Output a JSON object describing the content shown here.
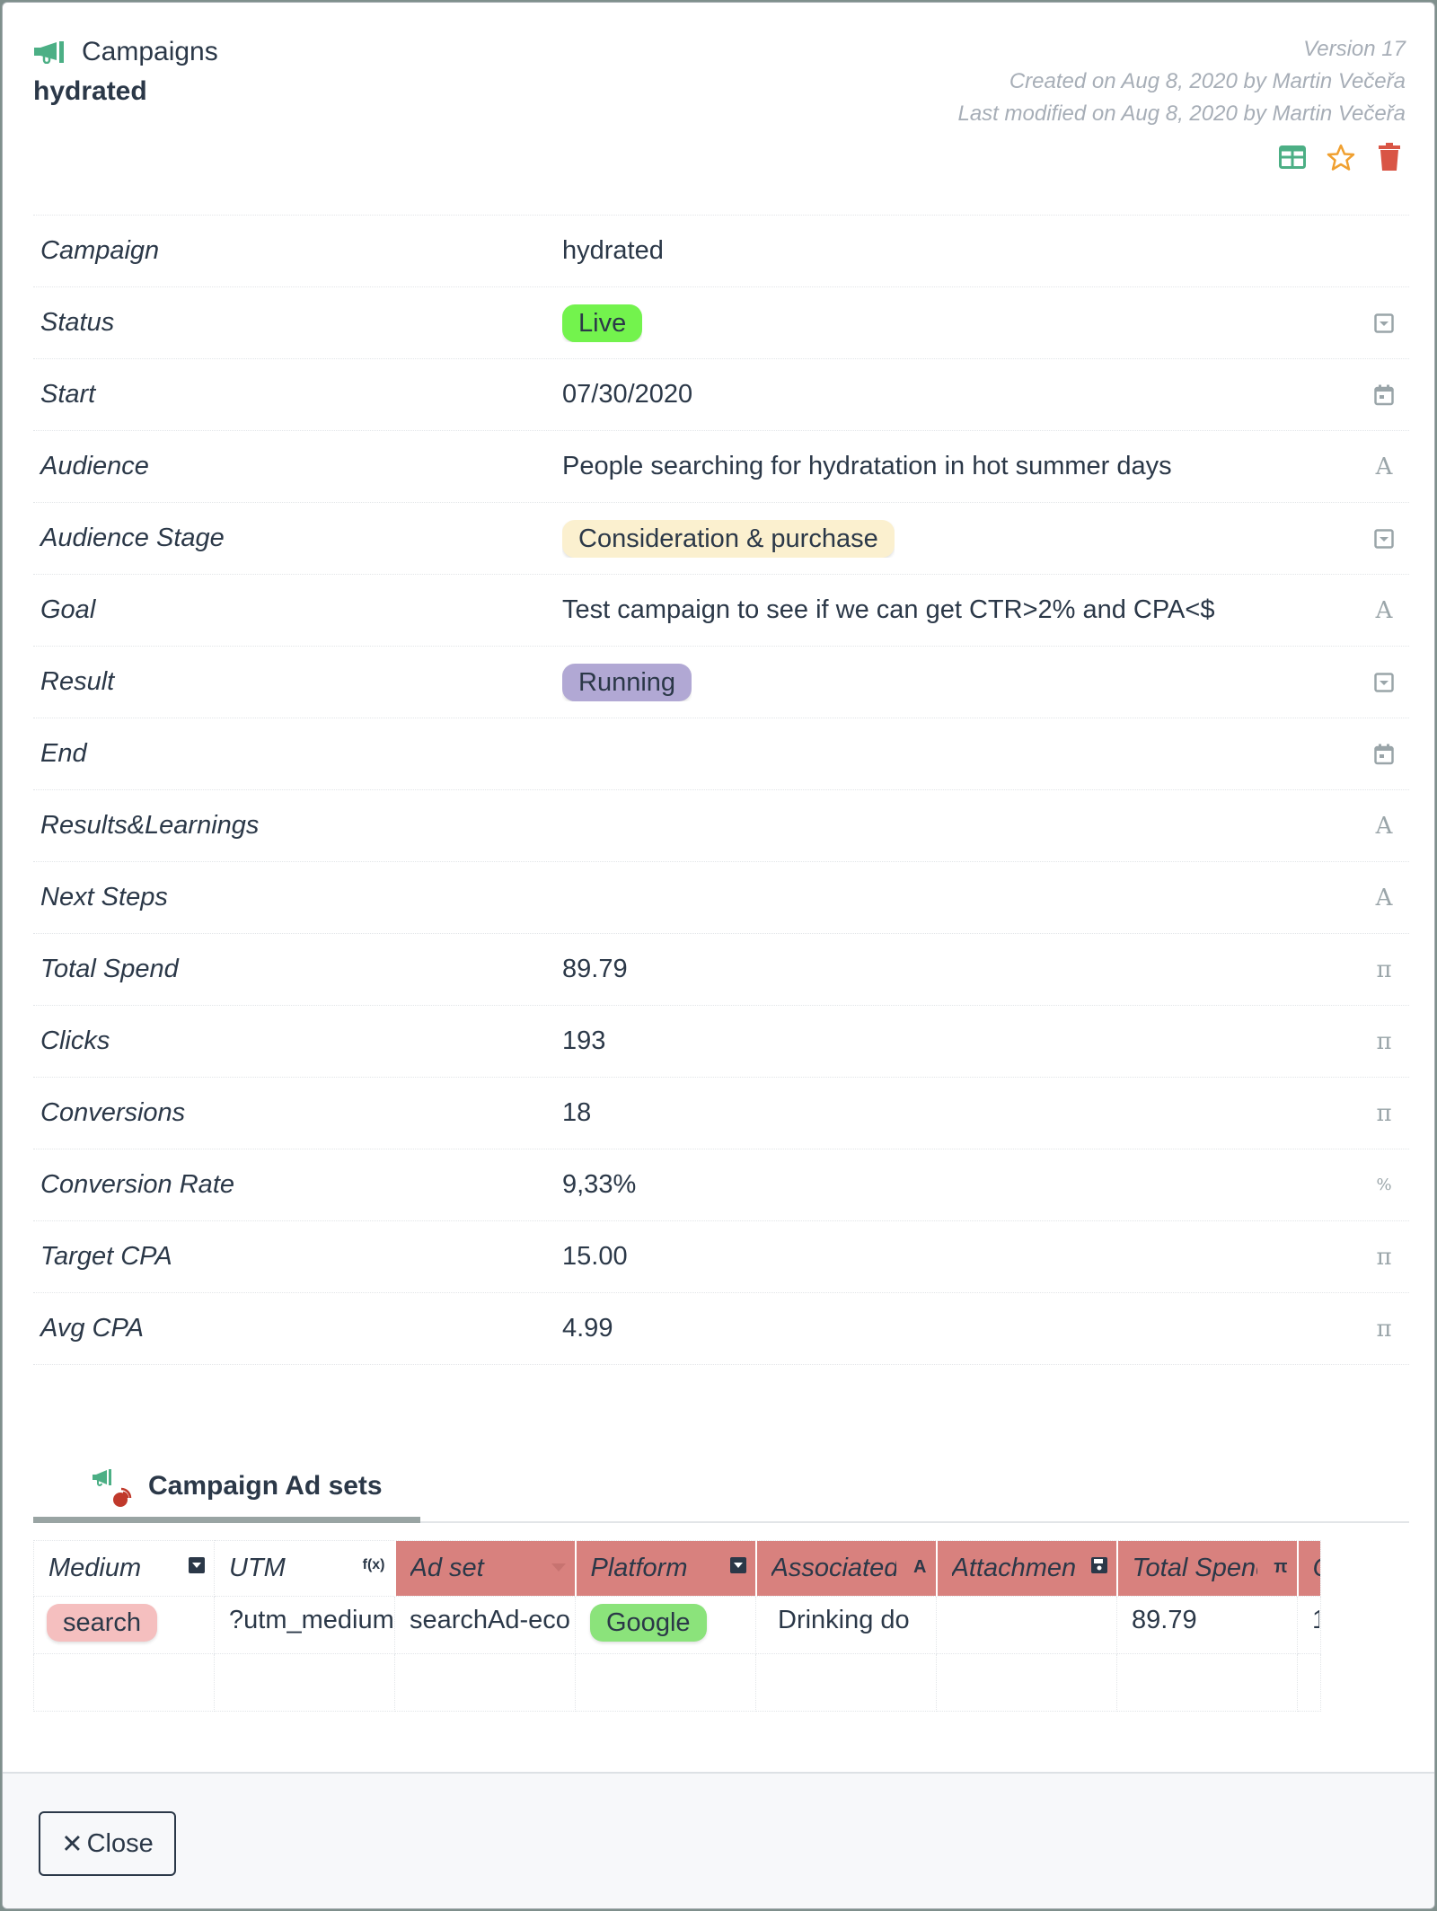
{
  "header": {
    "collection_icon": "megaphone-icon",
    "collection_name": "Campaigns",
    "record_title": "hydrated",
    "version": "Version 17",
    "created": "Created on Aug 8, 2020 by Martin Večeřa",
    "modified": "Last modified on Aug 8, 2020 by Martin Večeřa",
    "actions": [
      {
        "name": "table-view",
        "icon": "grid-icon",
        "color": "#4caf85"
      },
      {
        "name": "favorite",
        "icon": "star-icon",
        "color": "#f0a030"
      },
      {
        "name": "delete",
        "icon": "trash-icon",
        "color": "#d95545"
      }
    ]
  },
  "fields": [
    {
      "label": "Campaign",
      "value": "hydrated",
      "type": "",
      "type_icon": ""
    },
    {
      "label": "Status",
      "value": "Live",
      "pill": true,
      "pill_color": "#73f34d",
      "type_icon": "dropdown-icon"
    },
    {
      "label": "Start",
      "value": "07/30/2020",
      "type_icon": "calendar-icon"
    },
    {
      "label": "Audience",
      "value": "People searching for hydratation in hot summer days",
      "type_icon": "text-icon"
    },
    {
      "label": "Audience Stage",
      "value": "Consideration & purchase",
      "pill": true,
      "pill_color": "#fbf0cf",
      "type_icon": "dropdown-icon"
    },
    {
      "label": "Goal",
      "value": "Test campaign to see if we can get CTR>2% and CPA<$",
      "type_icon": "text-icon"
    },
    {
      "label": "Result",
      "value": "Running",
      "pill": true,
      "pill_color": "#b1a8d4",
      "type_icon": "dropdown-icon"
    },
    {
      "label": "End",
      "value": "",
      "type_icon": "calendar-icon"
    },
    {
      "label": "Results&Learnings",
      "value": "",
      "type_icon": "text-icon"
    },
    {
      "label": "Next Steps",
      "value": "",
      "type_icon": "text-icon"
    },
    {
      "label": "Total Spend",
      "value": "89.79",
      "type_icon": "formula-icon"
    },
    {
      "label": "Clicks",
      "value": "193",
      "type_icon": "formula-icon"
    },
    {
      "label": "Conversions",
      "value": "18",
      "type_icon": "formula-icon"
    },
    {
      "label": "Conversion Rate",
      "value": "9,33%",
      "type_icon": "percent-icon"
    },
    {
      "label": "Target CPA",
      "value": "15.00",
      "type_icon": "formula-icon"
    },
    {
      "label": "Avg CPA",
      "value": "4.99",
      "type_icon": "formula-icon"
    }
  ],
  "adsets": {
    "tab_label": "Campaign Ad sets",
    "columns": [
      {
        "label": "Medium",
        "icon": "▾",
        "icon_name": "dropdown-icon",
        "highlight": false
      },
      {
        "label": "UTM",
        "icon": "f(x)",
        "icon_name": "function-icon",
        "highlight": false
      },
      {
        "label": "Ad set",
        "icon": "▾",
        "icon_name": "sort-icon",
        "highlight": true
      },
      {
        "label": "Platform",
        "icon": "▾",
        "icon_name": "dropdown-icon",
        "highlight": true
      },
      {
        "label": "Associated",
        "icon": "A",
        "icon_name": "text-icon",
        "highlight": true
      },
      {
        "label": "Attachmen",
        "icon": "💾",
        "icon_name": "attachment-icon",
        "highlight": true
      },
      {
        "label": "Total Spend",
        "icon": "π",
        "icon_name": "formula-icon",
        "highlight": true
      },
      {
        "label": "C",
        "icon": "",
        "icon_name": "",
        "highlight": true
      }
    ],
    "rows": [
      {
        "medium": "search",
        "medium_color": "#f5bfbf",
        "utm": "?utm_medium",
        "adset": "searchAd-eco",
        "platform": "Google",
        "platform_color": "#8be37b",
        "associated": "Drinking do",
        "attachment": "",
        "total_spend": "89.79",
        "c": "1"
      }
    ]
  },
  "footer": {
    "close_label": "Close",
    "close_icon": "✕"
  }
}
